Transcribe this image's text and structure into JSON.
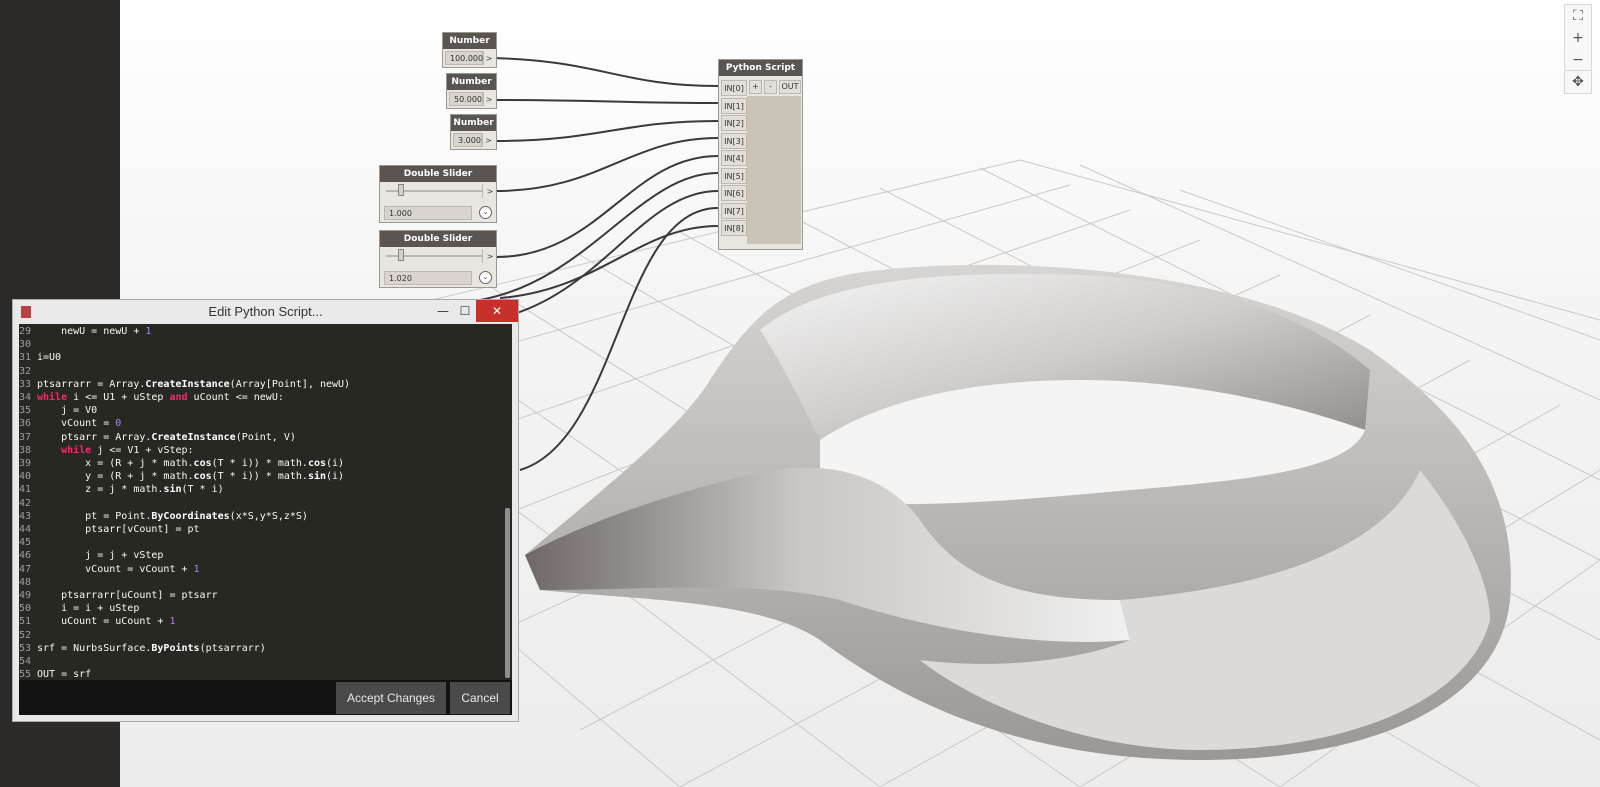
{
  "viewport": {
    "zoom_controls": {
      "fit_label": "⛶",
      "zoom_in_label": "+",
      "zoom_out_label": "−",
      "pan_label": "✥"
    }
  },
  "nodes": {
    "number_1": {
      "title": "Number",
      "value": "100.000",
      "output_label": ">"
    },
    "number_2": {
      "title": "Number",
      "value": "50.000",
      "output_label": ">"
    },
    "number_3": {
      "title": "Number",
      "value": "3.000",
      "output_label": ">"
    },
    "slider_1": {
      "title": "Double Slider",
      "value": "1.000",
      "output_label": ">",
      "level": 0.2
    },
    "slider_2": {
      "title": "Double Slider",
      "value": "1.020",
      "output_label": ">",
      "level": 0.2
    },
    "python": {
      "title": "Python Script",
      "add_label": "+",
      "remove_label": "-",
      "output_label": "OUT",
      "inputs": [
        "IN[0]",
        "IN[1]",
        "IN[2]",
        "IN[3]",
        "IN[4]",
        "IN[5]",
        "IN[6]",
        "IN[7]",
        "IN[8]"
      ]
    }
  },
  "editor": {
    "title": "Edit Python Script...",
    "minimize_label": "—",
    "maximize_label": "☐",
    "close_label": "✕",
    "accept_label": "Accept Changes",
    "cancel_label": "Cancel",
    "lines": [
      {
        "n": "29",
        "segments": [
          {
            "t": "    newU = newU + "
          },
          {
            "t": "1",
            "c": "num"
          }
        ]
      },
      {
        "n": "30",
        "segments": []
      },
      {
        "n": "31",
        "segments": [
          {
            "t": "i=U0"
          }
        ]
      },
      {
        "n": "32",
        "segments": []
      },
      {
        "n": "33",
        "segments": [
          {
            "t": "ptsarrarr = Array."
          },
          {
            "t": "CreateInstance",
            "c": "fn"
          },
          {
            "t": "(Array[Point], newU)"
          }
        ]
      },
      {
        "n": "34",
        "segments": [
          {
            "t": "while",
            "c": "kw"
          },
          {
            "t": " i <= U1 + uStep "
          },
          {
            "t": "and",
            "c": "kw"
          },
          {
            "t": " uCount <= newU:"
          }
        ]
      },
      {
        "n": "35",
        "segments": [
          {
            "t": "    j = V0"
          }
        ]
      },
      {
        "n": "36",
        "segments": [
          {
            "t": "    vCount = "
          },
          {
            "t": "0",
            "c": "num"
          }
        ]
      },
      {
        "n": "37",
        "segments": [
          {
            "t": "    ptsarr = Array."
          },
          {
            "t": "CreateInstance",
            "c": "fn"
          },
          {
            "t": "(Point, V)"
          }
        ]
      },
      {
        "n": "38",
        "segments": [
          {
            "t": "    "
          },
          {
            "t": "while",
            "c": "kw"
          },
          {
            "t": " j <= V1 + vStep:"
          }
        ]
      },
      {
        "n": "39",
        "segments": [
          {
            "t": "        x = (R + j * math."
          },
          {
            "t": "cos",
            "c": "fn"
          },
          {
            "t": "(T * i)) * math."
          },
          {
            "t": "cos",
            "c": "fn"
          },
          {
            "t": "(i)"
          }
        ]
      },
      {
        "n": "40",
        "segments": [
          {
            "t": "        y = (R + j * math."
          },
          {
            "t": "cos",
            "c": "fn"
          },
          {
            "t": "(T * i)) * math."
          },
          {
            "t": "sin",
            "c": "fn"
          },
          {
            "t": "(i)"
          }
        ]
      },
      {
        "n": "41",
        "segments": [
          {
            "t": "        z = j * math."
          },
          {
            "t": "sin",
            "c": "fn"
          },
          {
            "t": "(T * i)"
          }
        ]
      },
      {
        "n": "42",
        "segments": []
      },
      {
        "n": "43",
        "segments": [
          {
            "t": "        pt = Point."
          },
          {
            "t": "ByCoordinates",
            "c": "fn"
          },
          {
            "t": "(x*S,y*S,z*S)"
          }
        ]
      },
      {
        "n": "44",
        "segments": [
          {
            "t": "        ptsarr[vCount] = pt"
          }
        ]
      },
      {
        "n": "45",
        "segments": []
      },
      {
        "n": "46",
        "segments": [
          {
            "t": "        j = j + vStep"
          }
        ]
      },
      {
        "n": "47",
        "segments": [
          {
            "t": "        vCount = vCount + "
          },
          {
            "t": "1",
            "c": "num"
          }
        ]
      },
      {
        "n": "48",
        "segments": []
      },
      {
        "n": "49",
        "segments": [
          {
            "t": "    ptsarrarr[uCount] = ptsarr"
          }
        ]
      },
      {
        "n": "50",
        "segments": [
          {
            "t": "    i = i + uStep"
          }
        ]
      },
      {
        "n": "51",
        "segments": [
          {
            "t": "    uCount = uCount + "
          },
          {
            "t": "1",
            "c": "num"
          }
        ]
      },
      {
        "n": "52",
        "segments": []
      },
      {
        "n": "53",
        "segments": [
          {
            "t": "srf = NurbsSurface."
          },
          {
            "t": "ByPoints",
            "c": "fn"
          },
          {
            "t": "(ptsarrarr)"
          }
        ]
      },
      {
        "n": "54",
        "segments": []
      },
      {
        "n": "55",
        "segments": [
          {
            "t": "OUT = srf"
          }
        ]
      }
    ]
  }
}
